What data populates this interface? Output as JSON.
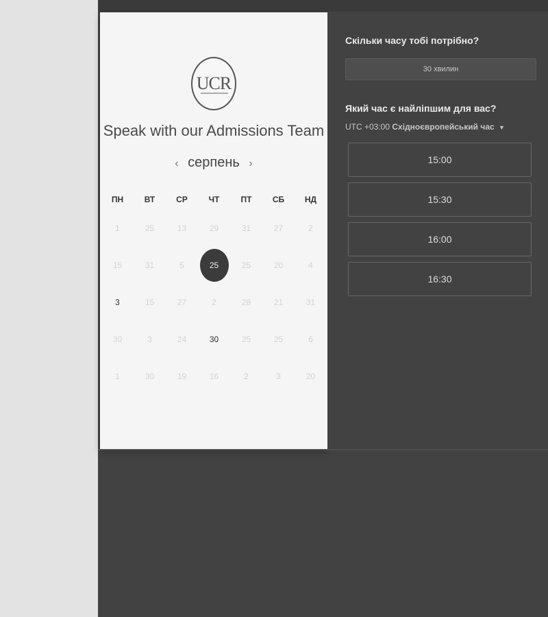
{
  "booking": {
    "logo_text": "UCR",
    "title": "Speak with our Admissions Team",
    "month": "серпень",
    "weekdays": [
      "ПН",
      "ВТ",
      "СР",
      "ЧТ",
      "ПТ",
      "СБ",
      "НД"
    ],
    "weeks": [
      [
        "1",
        "25",
        "13",
        "29",
        "31",
        "27",
        "2"
      ],
      [
        "15",
        "31",
        "5",
        "25",
        "25",
        "20",
        "4"
      ],
      [
        "3",
        "15",
        "27",
        "2",
        "28",
        "21",
        "31"
      ],
      [
        "30",
        "3",
        "24",
        "30",
        "25",
        "25",
        "6"
      ],
      [
        "1",
        "30",
        "19",
        "16",
        "2",
        "3",
        "20"
      ]
    ],
    "active_days": [
      {
        "week": 2,
        "day": 0
      },
      {
        "week": 3,
        "day": 3
      }
    ],
    "selected_day": {
      "week": 1,
      "day": 3
    }
  },
  "right": {
    "duration_heading": "Скільки часу тобі потрібно?",
    "duration_value": "30 хвилин",
    "time_heading": "Який час є найліпшим для вас?",
    "tz_offset": "UTC +03:00",
    "tz_name": "Східноєвропейський час",
    "slots": [
      "15:00",
      "15:30",
      "16:00",
      "16:30"
    ]
  },
  "colors": {
    "dark_bg": "#424242",
    "left_card_bg": "#f5f5f5",
    "selected_bubble": "#3b3b3b"
  }
}
